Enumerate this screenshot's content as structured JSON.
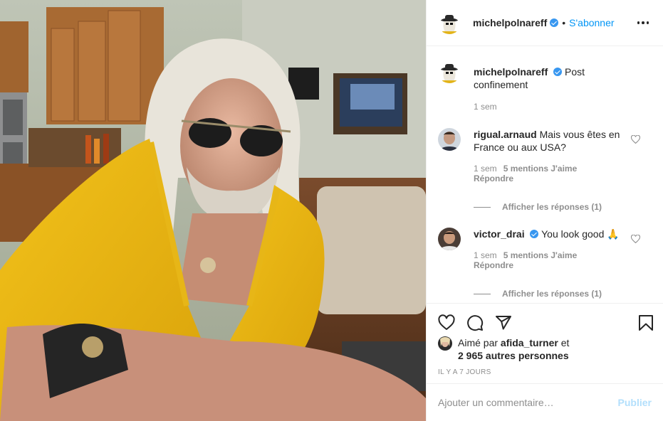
{
  "post": {
    "author": "michelpolnareff",
    "separator": "•",
    "follow_label": "S'abonner",
    "caption": "Post confinement",
    "caption_time": "1 sem"
  },
  "comments": [
    {
      "username": "rigual.arnaud",
      "verified": false,
      "text": "Mais vous êtes en France ou aux USA?",
      "time": "1 sem",
      "likes": "5 mentions J'aime",
      "reply_label": "Répondre",
      "view_replies": "Afficher les réponses (1)"
    },
    {
      "username": "victor_drai",
      "verified": true,
      "text": "You look good 🙏",
      "time": "1 sem",
      "likes": "5 mentions J'aime",
      "reply_label": "Répondre",
      "view_replies": "Afficher les réponses (1)"
    }
  ],
  "likes": {
    "prefix": "Aimé par",
    "user": "afida_turner",
    "suffix": "et",
    "others": "2 965 autres personnes"
  },
  "date_label": "IL Y A 7 JOURS",
  "add_comment": {
    "placeholder": "Ajouter un commentaire…",
    "publish_label": "Publier"
  },
  "icons": {
    "more": "more-options-icon",
    "like": "heart-icon",
    "comment": "comment-icon",
    "share": "share-icon",
    "save": "bookmark-icon",
    "verified": "verified-badge-icon"
  },
  "colors": {
    "link_blue": "#0095f6",
    "verified_blue": "#3897f0",
    "secondary_text": "#8e8e8e",
    "publish_disabled": "#b2dffc"
  }
}
